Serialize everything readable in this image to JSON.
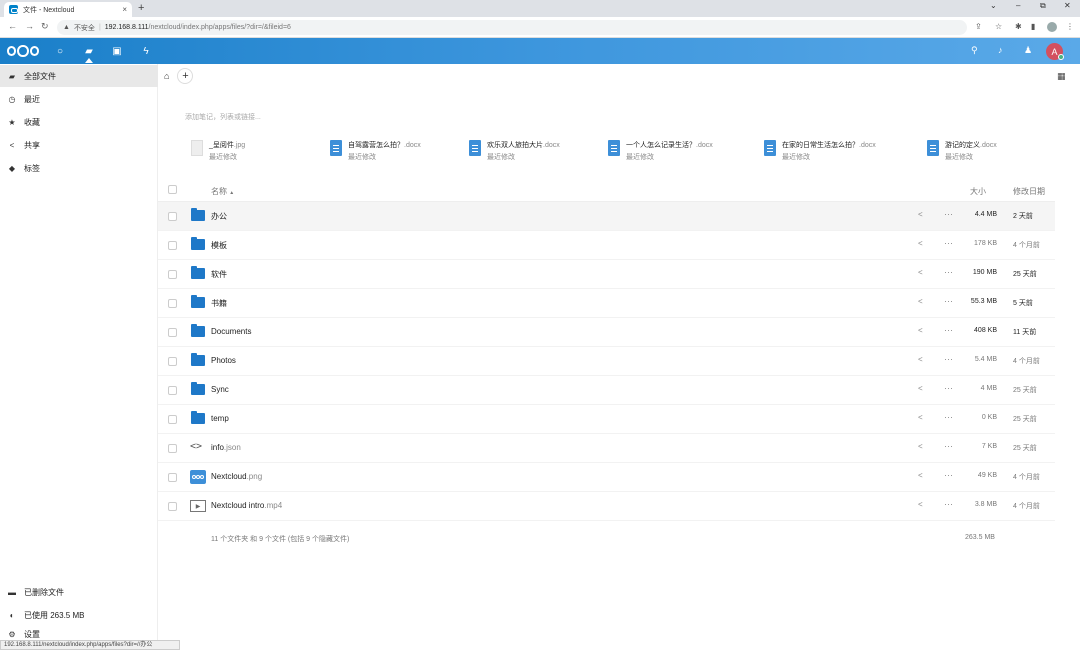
{
  "browser": {
    "tab_title": "文件 - Nextcloud",
    "tab_close": "×",
    "new_tab": "+",
    "insecure_label": "不安全",
    "url_host": "192.168.8.111",
    "url_rest": "/nextcloud/index.php/apps/files/?dir=/&fileid=6",
    "status_url": "192.168.8.111/nextcloud/index.php/apps/files?dir=//办公"
  },
  "sidebar": {
    "items": [
      {
        "label": "全部文件",
        "icon": "folder-icon"
      },
      {
        "label": "最近",
        "icon": "clock-icon"
      },
      {
        "label": "收藏",
        "icon": "star-icon"
      },
      {
        "label": "共享",
        "icon": "share-icon"
      },
      {
        "label": "标签",
        "icon": "tag-icon"
      }
    ],
    "bottom": [
      {
        "label": "已删除文件",
        "icon": "trash-icon"
      },
      {
        "label": "已使用 263.5 MB",
        "icon": "pie-icon"
      },
      {
        "label": "设置",
        "icon": "gear-icon"
      }
    ]
  },
  "header": {
    "avatar_letter": "A"
  },
  "main": {
    "note_placeholder": "添加笔记，列表或链接...",
    "recent": [
      {
        "name": "_呈阅件",
        "ext": ".jpg",
        "sub": "最近修改"
      },
      {
        "name": "自驾露营怎么拍？",
        "ext": ".docx",
        "sub": "最近修改"
      },
      {
        "name": "欢乐双人旅拍大片",
        "ext": ".docx",
        "sub": "最近修改"
      },
      {
        "name": "一个人怎么记录生活？",
        "ext": ".docx",
        "sub": "最近修改"
      },
      {
        "name": "在家的日常生活怎么拍？",
        "ext": ".docx",
        "sub": "最近修改"
      },
      {
        "name": "游记的定义",
        "ext": ".docx",
        "sub": "最近修改"
      }
    ],
    "columns": {
      "name": "名称",
      "sort": "▲",
      "size": "大小",
      "modified": "修改日期"
    },
    "files": [
      {
        "name": "办公",
        "ext": "",
        "size": "4.4 MB",
        "date": "2 天前",
        "type": "folder"
      },
      {
        "name": "模板",
        "ext": "",
        "size": "178 KB",
        "date": "4 个月前",
        "type": "folder"
      },
      {
        "name": "软件",
        "ext": "",
        "size": "190 MB",
        "date": "25 天前",
        "type": "folder"
      },
      {
        "name": "书籍",
        "ext": "",
        "size": "55.3 MB",
        "date": "5 天前",
        "type": "folder"
      },
      {
        "name": "Documents",
        "ext": "",
        "size": "408 KB",
        "date": "11 天前",
        "type": "folder"
      },
      {
        "name": "Photos",
        "ext": "",
        "size": "5.4 MB",
        "date": "4 个月前",
        "type": "folder"
      },
      {
        "name": "Sync",
        "ext": "",
        "size": "4 MB",
        "date": "25 天前",
        "type": "folder"
      },
      {
        "name": "temp",
        "ext": "",
        "size": "0 KB",
        "date": "25 天前",
        "type": "folder"
      },
      {
        "name": "info",
        "ext": ".json",
        "size": "7 KB",
        "date": "25 天前",
        "type": "code"
      },
      {
        "name": "Nextcloud",
        "ext": ".png",
        "size": "49 KB",
        "date": "4 个月前",
        "type": "image"
      },
      {
        "name": "Nextcloud intro",
        "ext": ".mp4",
        "size": "3.8 MB",
        "date": "4 个月前",
        "type": "video"
      }
    ],
    "summary": "11 个文件夹 和 9 个文件 (包括 9 个隐藏文件)",
    "summary_size": "263.5 MB"
  }
}
